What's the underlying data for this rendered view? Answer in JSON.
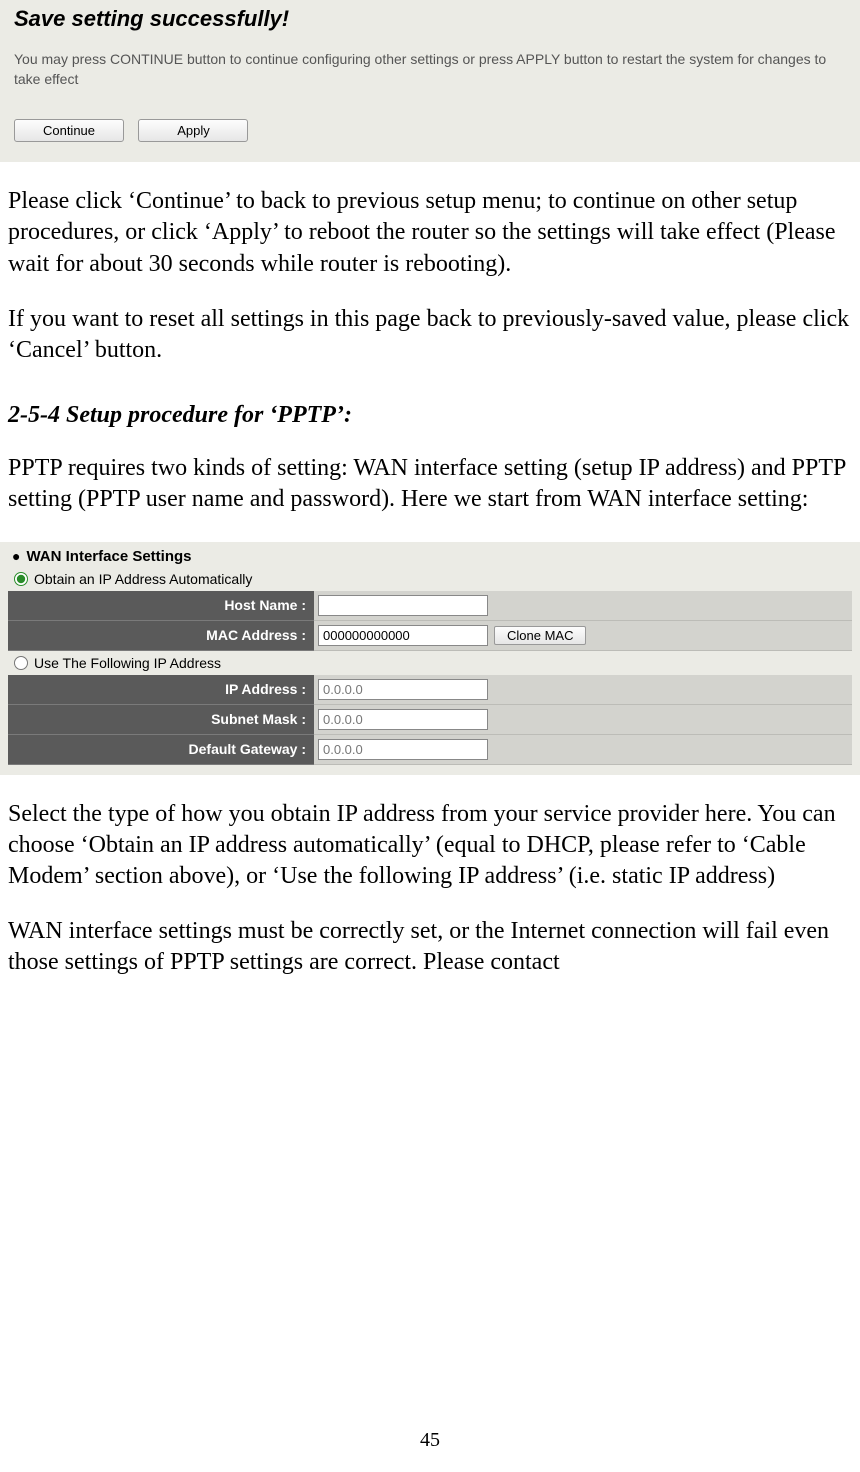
{
  "panel1": {
    "title": "Save setting successfully!",
    "description": "You may press CONTINUE button to continue configuring other settings or press APPLY button to restart the system for changes to take effect",
    "continue_label": "Continue",
    "apply_label": "Apply"
  },
  "para1": "Please click ‘Continue’ to back to previous setup menu; to continue on other setup procedures, or click ‘Apply’ to reboot the router so the settings will take effect (Please wait for about 30 seconds while router is rebooting).",
  "para2": "If you want to reset all settings in this page back to previously-saved value, please click ‘Cancel’ button.",
  "section_heading": "2-5-4 Setup procedure for ‘PPTP’:",
  "para3": "PPTP requires two kinds of setting: WAN interface setting (setup IP address) and PPTP setting (PPTP user name and password). Here we start from WAN interface setting:",
  "panel2": {
    "section_label": "WAN Interface Settings",
    "radio_auto": "Obtain an IP Address Automatically",
    "radio_static": "Use The Following IP Address",
    "hostname_label": "Host Name :",
    "hostname_value": "",
    "mac_label": "MAC Address :",
    "mac_value": "000000000000",
    "clone_label": "Clone MAC",
    "ip_label": "IP Address :",
    "ip_value": "0.0.0.0",
    "subnet_label": "Subnet Mask :",
    "subnet_value": "0.0.0.0",
    "gateway_label": "Default Gateway :",
    "gateway_value": "0.0.0.0"
  },
  "para4": "Select the type of how you obtain IP address from your service provider here. You can choose ‘Obtain an IP address automatically’ (equal to DHCP, please refer to ‘Cable Modem’ section above), or ‘Use the following IP address’ (i.e. static IP address)",
  "para5": "WAN interface settings must be correctly set, or the Internet connection will fail even those settings of PPTP settings are correct. Please contact",
  "page_number": "45"
}
